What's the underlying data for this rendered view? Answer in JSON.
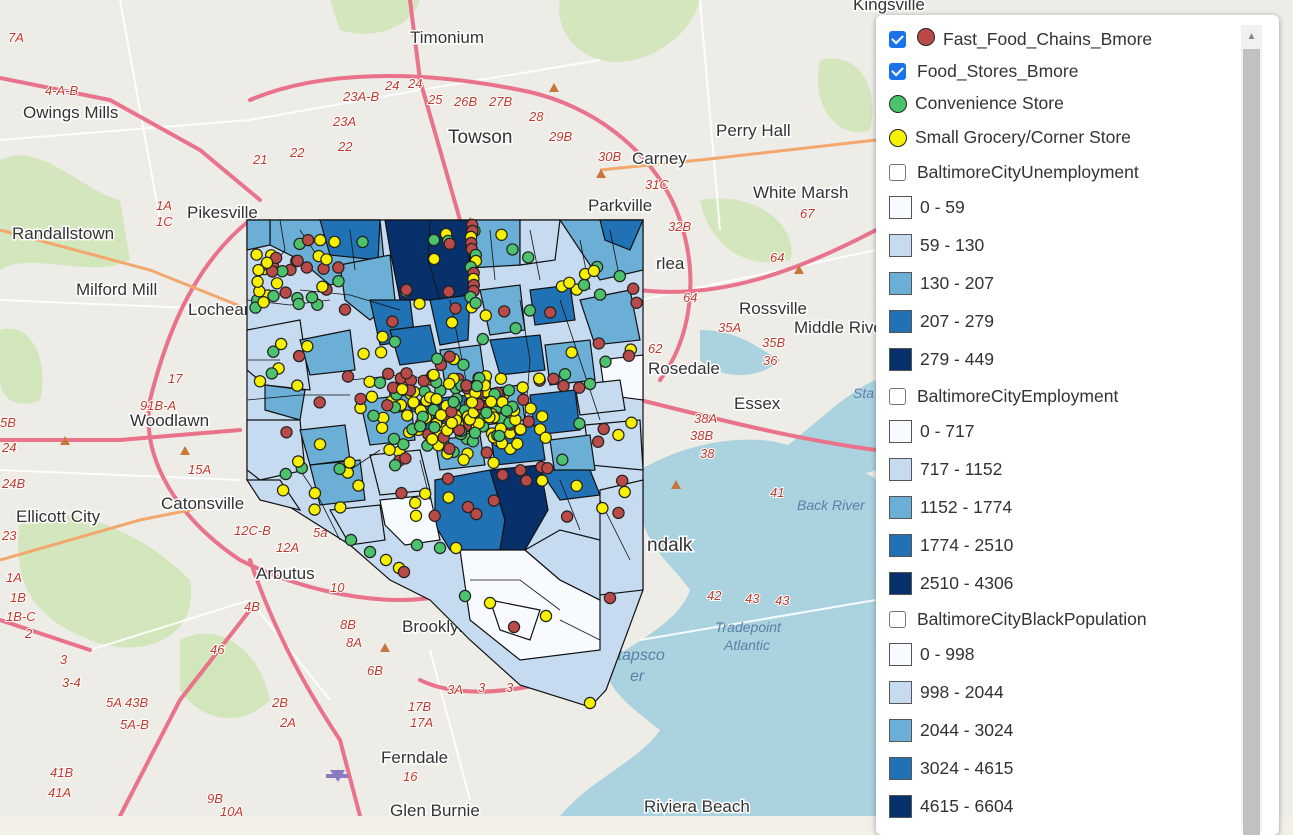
{
  "map": {
    "places": [
      {
        "name": "Kingsville"
      },
      {
        "name": "Timonium"
      },
      {
        "name": "Owings Mills"
      },
      {
        "name": "Towson"
      },
      {
        "name": "Perry Hall"
      },
      {
        "name": "Carney"
      },
      {
        "name": "Pikesville"
      },
      {
        "name": "Parkville"
      },
      {
        "name": "White Marsh"
      },
      {
        "name": "Randallstown"
      },
      {
        "name": "Milford Mill"
      },
      {
        "name": "Lochear"
      },
      {
        "name": "rlea"
      },
      {
        "name": "Rossville"
      },
      {
        "name": "Middle River"
      },
      {
        "name": "Rosedale"
      },
      {
        "name": "Essex"
      },
      {
        "name": "Woodlawn"
      },
      {
        "name": "Catonsville"
      },
      {
        "name": "Ellicott City"
      },
      {
        "name": "ndalk"
      },
      {
        "name": "Arbutus"
      },
      {
        "name": "Brooklyn"
      },
      {
        "name": "Ferndale"
      },
      {
        "name": "Glen Burnie"
      },
      {
        "name": "Riviera Beach"
      }
    ],
    "water_labels": [
      "Back River",
      "Patapsco",
      "Tradepoint Atlantic",
      "Sta"
    ]
  },
  "legend": {
    "items": [
      {
        "type": "layer",
        "label": "Fast_Food_Chains_Bmore",
        "checked": true,
        "dot": "#b94a48"
      },
      {
        "type": "layer",
        "label": "Food_Stores_Bmore",
        "checked": true
      },
      {
        "type": "symbol",
        "label": "Convenience Store",
        "color": "#4cc26d"
      },
      {
        "type": "symbol",
        "label": "Small Grocery/Corner Store",
        "color": "#f7f000"
      },
      {
        "type": "layer",
        "label": "BaltimoreCityUnemployment",
        "checked": false
      },
      {
        "type": "class",
        "label": "0 - 59",
        "color": "#f7fbff"
      },
      {
        "type": "class",
        "label": "59 - 130",
        "color": "#c6dbef"
      },
      {
        "type": "class",
        "label": "130 - 207",
        "color": "#6baed6"
      },
      {
        "type": "class",
        "label": "207 - 279",
        "color": "#2171b5"
      },
      {
        "type": "class",
        "label": "279 - 449",
        "color": "#08306b"
      },
      {
        "type": "layer",
        "label": "BaltimoreCityEmployment",
        "checked": false
      },
      {
        "type": "class",
        "label": "0 - 717",
        "color": "#f7fbff"
      },
      {
        "type": "class",
        "label": "717 - 1152",
        "color": "#c6dbef"
      },
      {
        "type": "class",
        "label": "1152 - 1774",
        "color": "#6baed6"
      },
      {
        "type": "class",
        "label": "1774 - 2510",
        "color": "#2171b5"
      },
      {
        "type": "class",
        "label": "2510 - 4306",
        "color": "#08306b"
      },
      {
        "type": "layer",
        "label": "BaltimoreCityBlackPopulation",
        "checked": false
      },
      {
        "type": "class",
        "label": "0 - 998",
        "color": "#f7fbff"
      },
      {
        "type": "class",
        "label": "998 - 2044",
        "color": "#c6dbef"
      },
      {
        "type": "class",
        "label": "2044 - 3024",
        "color": "#6baed6"
      },
      {
        "type": "class",
        "label": "3024 - 4615",
        "color": "#2171b5"
      },
      {
        "type": "class",
        "label": "4615 - 6604",
        "color": "#08306b"
      }
    ]
  },
  "colors": {
    "fast_food": "#b94a48",
    "convenience": "#4cc26d",
    "corner_store": "#f7f000",
    "water": "#aad3df",
    "highway": "#e8738a"
  }
}
